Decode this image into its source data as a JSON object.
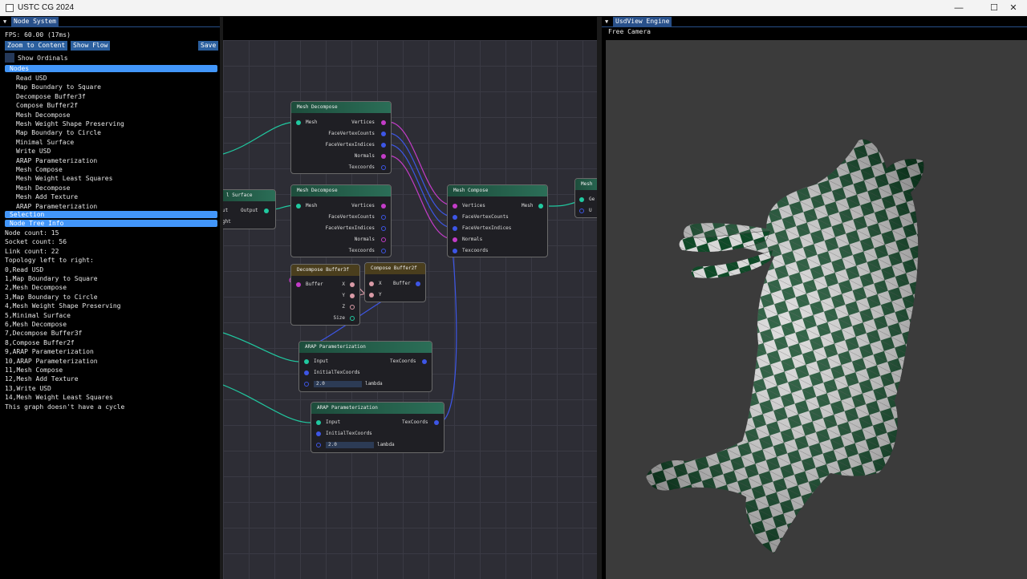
{
  "window": {
    "title": "USTC CG 2024",
    "minimize": "—",
    "maximize": "☐",
    "close": "✕"
  },
  "left_panel": {
    "tab": "Node System",
    "fps": "FPS: 60.00 (17ms)",
    "buttons": {
      "zoom": "Zoom to Content",
      "flow": "Show Flow",
      "save": "Save"
    },
    "show_ordinals": "Show Ordinals",
    "nodes_header": "Nodes",
    "nodes": [
      "Read USD",
      "Map Boundary to Square",
      "Decompose Buffer3f",
      "Compose Buffer2f",
      "Mesh Decompose",
      "Mesh Weight Shape Preserving",
      "Map Boundary to Circle",
      "Minimal Surface",
      "Write USD",
      "ARAP Parameterization",
      "Mesh Compose",
      "Mesh Weight Least Squares",
      "Mesh Decompose",
      "Mesh Add Texture",
      "ARAP Parameterization"
    ],
    "selection_header": "Selection",
    "tree_header": "Node Tree Info",
    "info": [
      "Node count: 15",
      "Socket count: 56",
      "Link count: 22",
      "Topology left to right:",
      "0,Read USD",
      "1,Map Boundary to Square",
      "2,Mesh Decompose",
      "3,Map Boundary to Circle",
      "4,Mesh Weight Shape Preserving",
      "5,Minimal Surface",
      "6,Mesh Decompose",
      "7,Decompose Buffer3f",
      "8,Compose Buffer2f",
      "9,ARAP Parameterization",
      "10,ARAP Parameterization",
      "11,Mesh Compose",
      "12,Mesh Add Texture",
      "13,Write USD",
      "14,Mesh Weight Least Squares",
      "This graph doesn't have a cycle"
    ]
  },
  "graph": {
    "mesh_decompose_a": {
      "title": "Mesh Decompose",
      "input": "Mesh",
      "outputs": [
        "Vertices",
        "FaceVertexCounts",
        "FaceVertexIndices",
        "Normals",
        "Texcoords"
      ]
    },
    "mesh_decompose_b": {
      "title": "Mesh Decompose",
      "input": "Mesh",
      "outputs": [
        "Vertices",
        "FaceVertexCounts",
        "FaceVertexIndices",
        "Normals",
        "Texcoords"
      ]
    },
    "minimal_surface": {
      "title": "l Surface",
      "in": "ut",
      "out": "Output",
      "in2": "ght"
    },
    "mesh_compose": {
      "title": "Mesh Compose",
      "inputs": [
        "Vertices",
        "FaceVertexCounts",
        "FaceVertexIndices",
        "Normals",
        "Texcoords"
      ],
      "output": "Mesh"
    },
    "edge_node": {
      "title": "Mesh",
      "port1": "Ge",
      "port2": "U"
    },
    "decompose_buffer3f": {
      "title": "Decompose Buffer3f",
      "input": "Buffer",
      "outputs": [
        "X",
        "Y",
        "Z",
        "Size"
      ]
    },
    "compose_buffer2f": {
      "title": "Compose Buffer2f",
      "inputs": [
        "X",
        "Y"
      ],
      "output": "Buffer"
    },
    "arap_a": {
      "title": "ARAP Parameterization",
      "input": "Input",
      "output": "TexCoords",
      "initial": "InitialTexCoords",
      "lambda_value": "2.0",
      "lambda_label": "lambda"
    },
    "arap_b": {
      "title": "ARAP Parameterization",
      "input": "Input",
      "output": "TexCoords",
      "initial": "InitialTexCoords",
      "lambda_value": "2.0",
      "lambda_label": "lambda"
    }
  },
  "right_panel": {
    "tab": "UsdView Engine",
    "camera": "Free Camera"
  },
  "colors": {
    "accent": "#4296fa",
    "tab": "#28508a",
    "button": "#2b5f9e",
    "checker_dark": "#0f4a28",
    "checker_light": "#d8d8d8"
  }
}
